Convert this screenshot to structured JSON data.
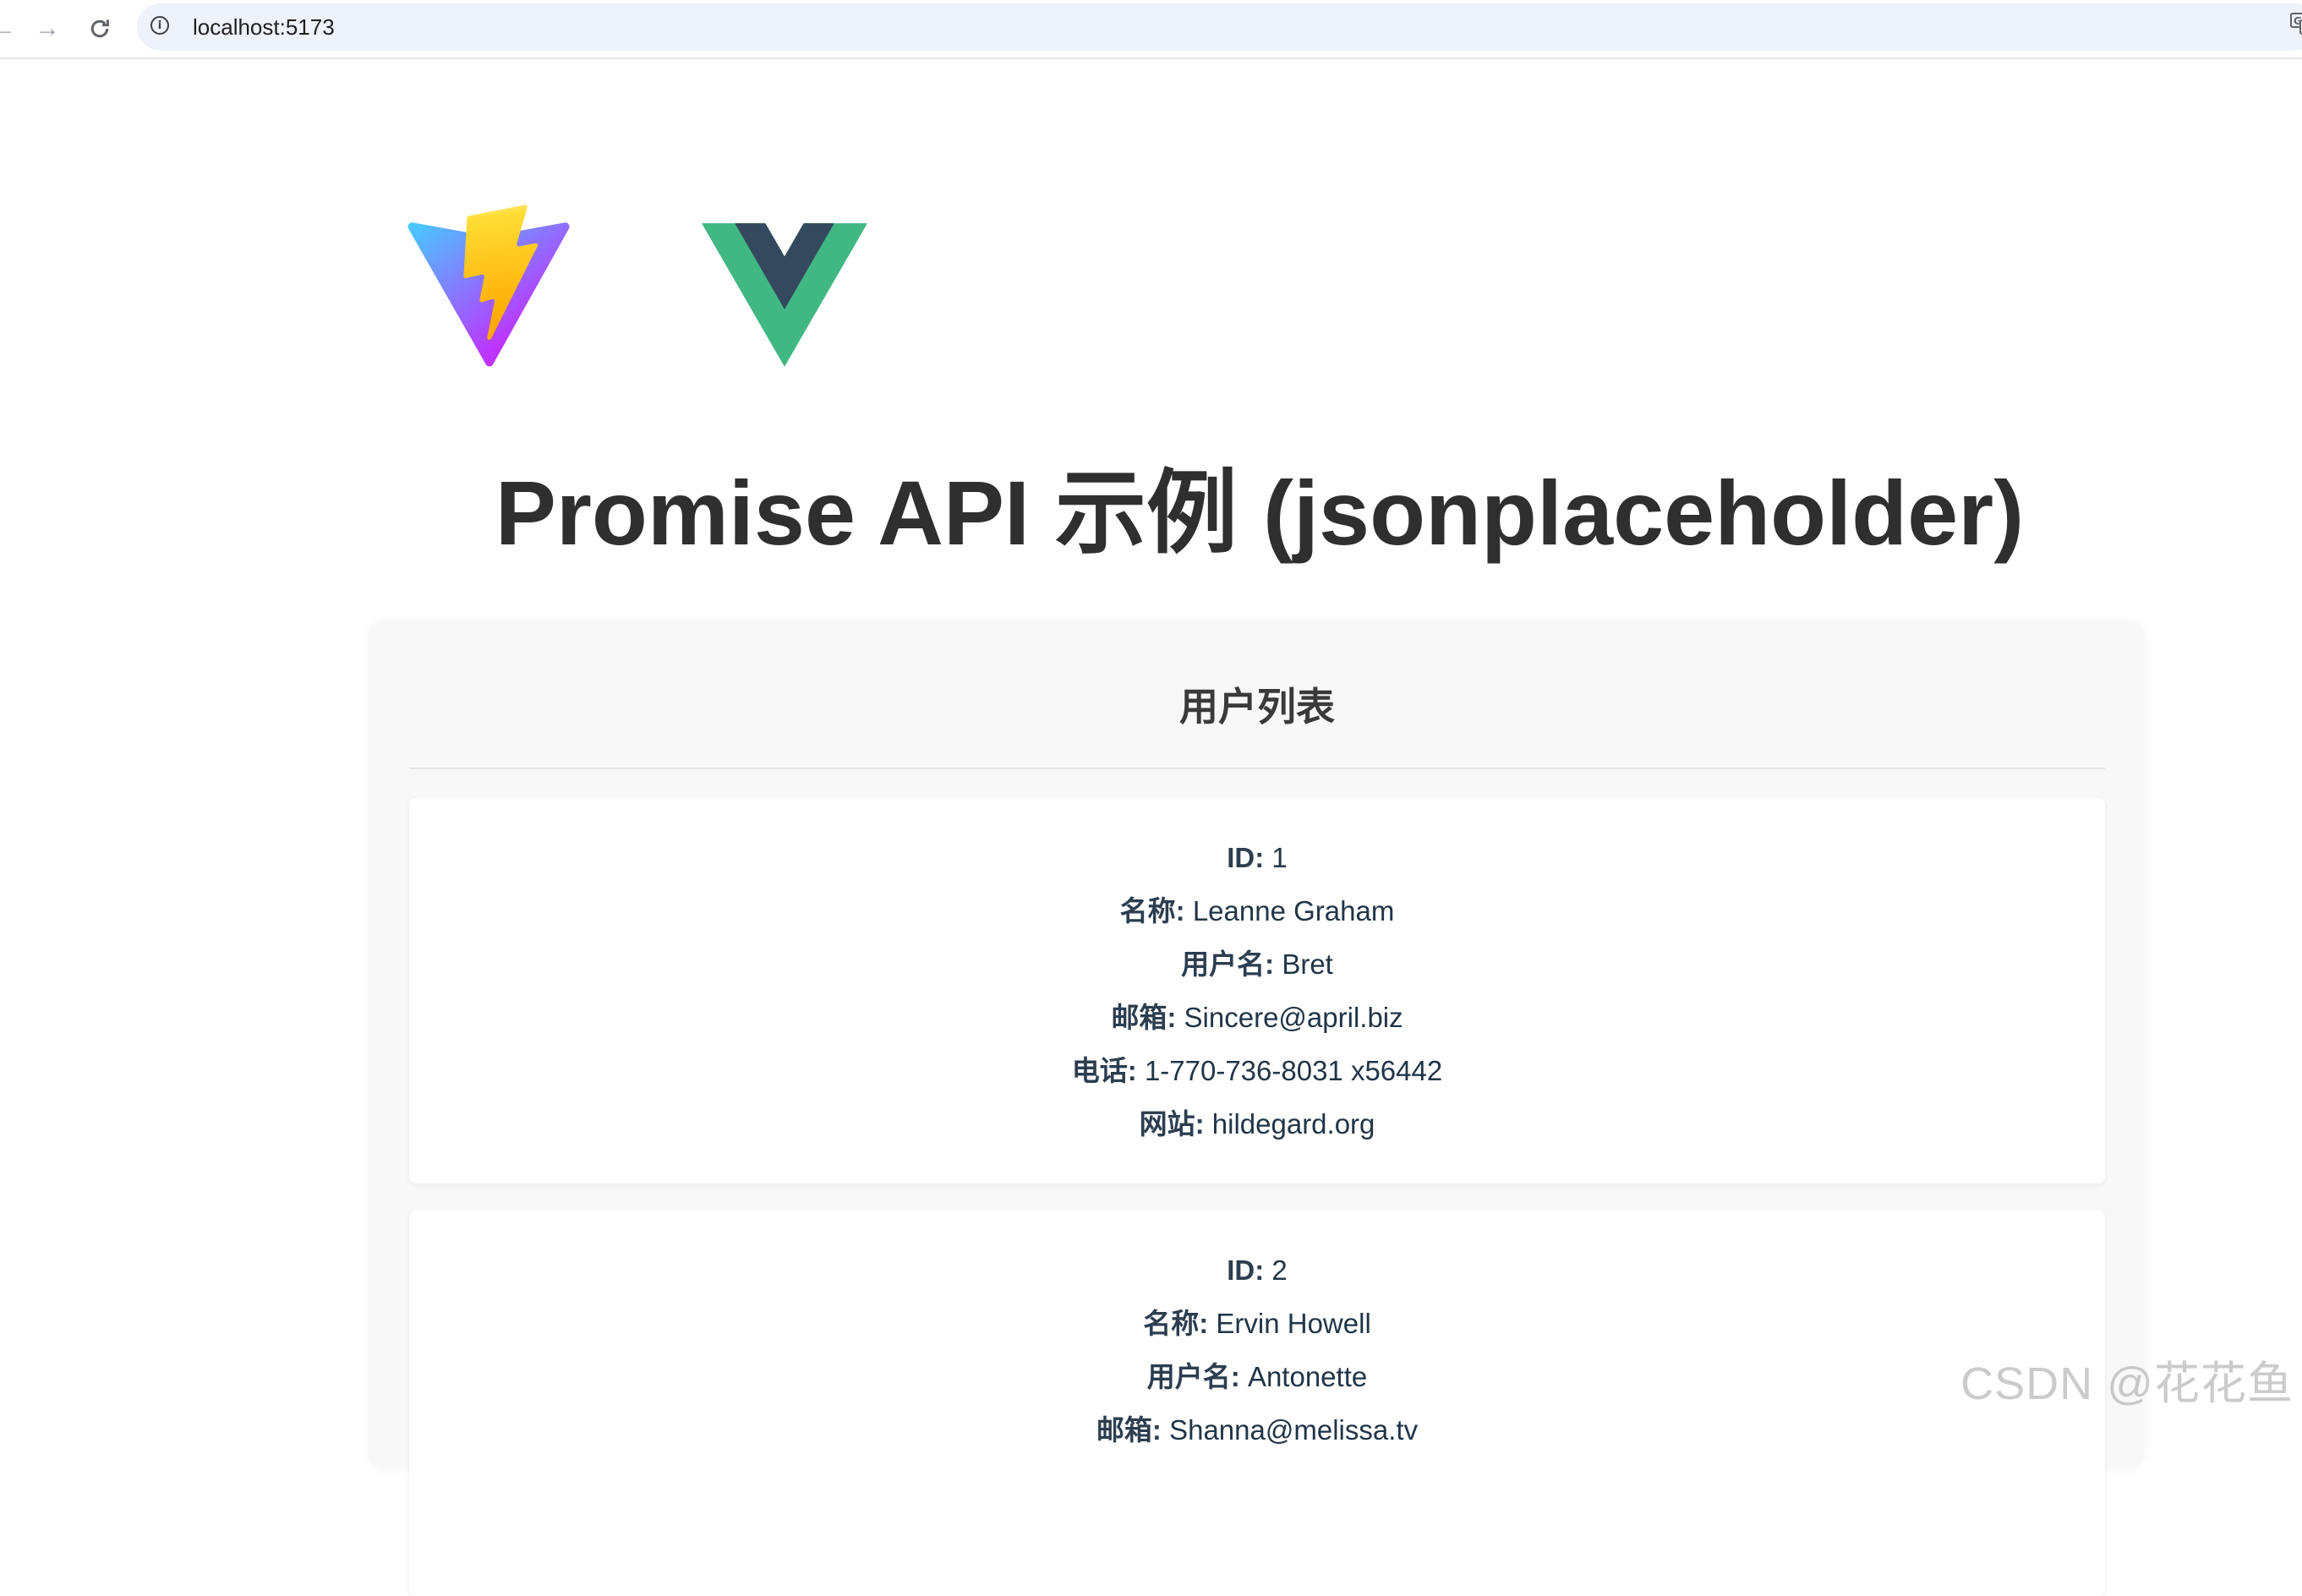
{
  "browser": {
    "url": "localhost:5173"
  },
  "page": {
    "title": "Promise API 示例 (jsonplaceholder)",
    "section_title": "用户列表"
  },
  "labels": {
    "id": "ID:",
    "name": "名称:",
    "username": "用户名:",
    "email": "邮箱:",
    "phone": "电话:",
    "website": "网站:"
  },
  "users": [
    {
      "id": "1",
      "name": "Leanne Graham",
      "username": "Bret",
      "email": "Sincere@april.biz",
      "phone": "1-770-736-8031 x56442",
      "website": "hildegard.org"
    },
    {
      "id": "2",
      "name": "Ervin Howell",
      "username": "Antonette",
      "email": "Shanna@melissa.tv"
    }
  ],
  "watermark": "CSDN @花花鱼",
  "colors": {
    "vue_green": "#42b883",
    "vue_dark": "#35495e",
    "vite_purple": "#bd34fe",
    "vite_blue": "#41d1ff",
    "vite_yellow": "#ffc517"
  },
  "icons": {
    "back": "back-arrow-icon",
    "forward": "forward-arrow-icon",
    "reload": "reload-icon",
    "info": "info-icon",
    "translate": "translate-icon"
  }
}
